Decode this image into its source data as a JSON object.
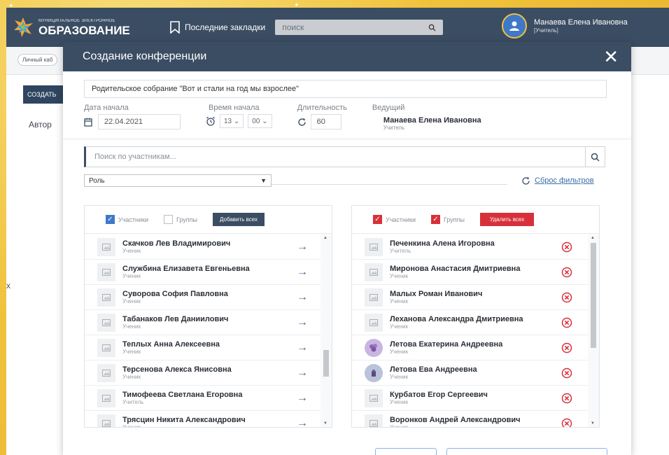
{
  "app": {
    "logo_small": "МУНИЦИПАЛЬНОЕ ЭЛЕКТРОННОЕ",
    "logo_big": "ОБРАЗОВАНИЕ",
    "bookmarks_label": "Последние закладки",
    "search_placeholder": "поиск",
    "user_name": "Манаева Елена Ивановна",
    "user_role": "[Учитель]",
    "crumb": "Личный каб",
    "create_label": "СОЗДАТЬ",
    "author_label": "Автор"
  },
  "modal": {
    "title": "Создание конференции",
    "conference_title": "Родительское собрание \"Вот и стали на год мы взрослее\"",
    "date_label": "Дата начала",
    "date_value": "22.04.2021",
    "time_label": "Время начала",
    "hour": "13",
    "minute": "00",
    "duration_label": "Длительность",
    "duration_value": "60",
    "host_label": "Ведущий",
    "host_name": "Манаева Елена Ивановна",
    "host_role": "Учитель",
    "participant_search_placeholder": "Поиск по участникам...",
    "role_select": "Роль",
    "reset_filters": "Сброс фильтров"
  },
  "left_panel": {
    "chk_participants": "Участники",
    "chk_groups": "Группы",
    "add_all": "Добавить всех",
    "items": [
      {
        "name": "Скачков Лев Владимирович",
        "role": "Ученик"
      },
      {
        "name": "Службина Елизавета Евгеньевна",
        "role": "Ученик"
      },
      {
        "name": "Суворова София Павловна",
        "role": "Ученик"
      },
      {
        "name": "Табанаков Лев Даниилович",
        "role": "Ученик"
      },
      {
        "name": "Теплых Анна Алексеевна",
        "role": "Ученик"
      },
      {
        "name": "Терсенова Алекса Янисовна",
        "role": "Ученик"
      },
      {
        "name": "Тимофеева Светлана Егоровна",
        "role": "Учитель"
      },
      {
        "name": "Трясцин Никита Александрович",
        "role": "Ученик"
      }
    ]
  },
  "right_panel": {
    "chk_participants": "Участники",
    "chk_groups": "Группы",
    "remove_all": "Удалить всех",
    "items": [
      {
        "name": "Печенкина Алена Игоровна",
        "role": "Учитель"
      },
      {
        "name": "Миронова Анастасия Дмитриевна",
        "role": "Ученик"
      },
      {
        "name": "Малых Роман Иванович",
        "role": "Ученик"
      },
      {
        "name": "Леханова Александра Дмитриевна",
        "role": "Ученик"
      },
      {
        "name": "Летова Екатерина Андреевна",
        "role": "Ученик"
      },
      {
        "name": "Летова Ева Андреевна",
        "role": "Ученик"
      },
      {
        "name": "Курбатов Егор Сергеевич",
        "role": "Ученик"
      },
      {
        "name": "Воронков Андрей Александрович",
        "role": "Ученик"
      }
    ]
  },
  "colors": {
    "header": "#3b4d63",
    "accent_blue": "#3f78c8",
    "danger": "#d8303a",
    "frame": "#f0c23b"
  }
}
